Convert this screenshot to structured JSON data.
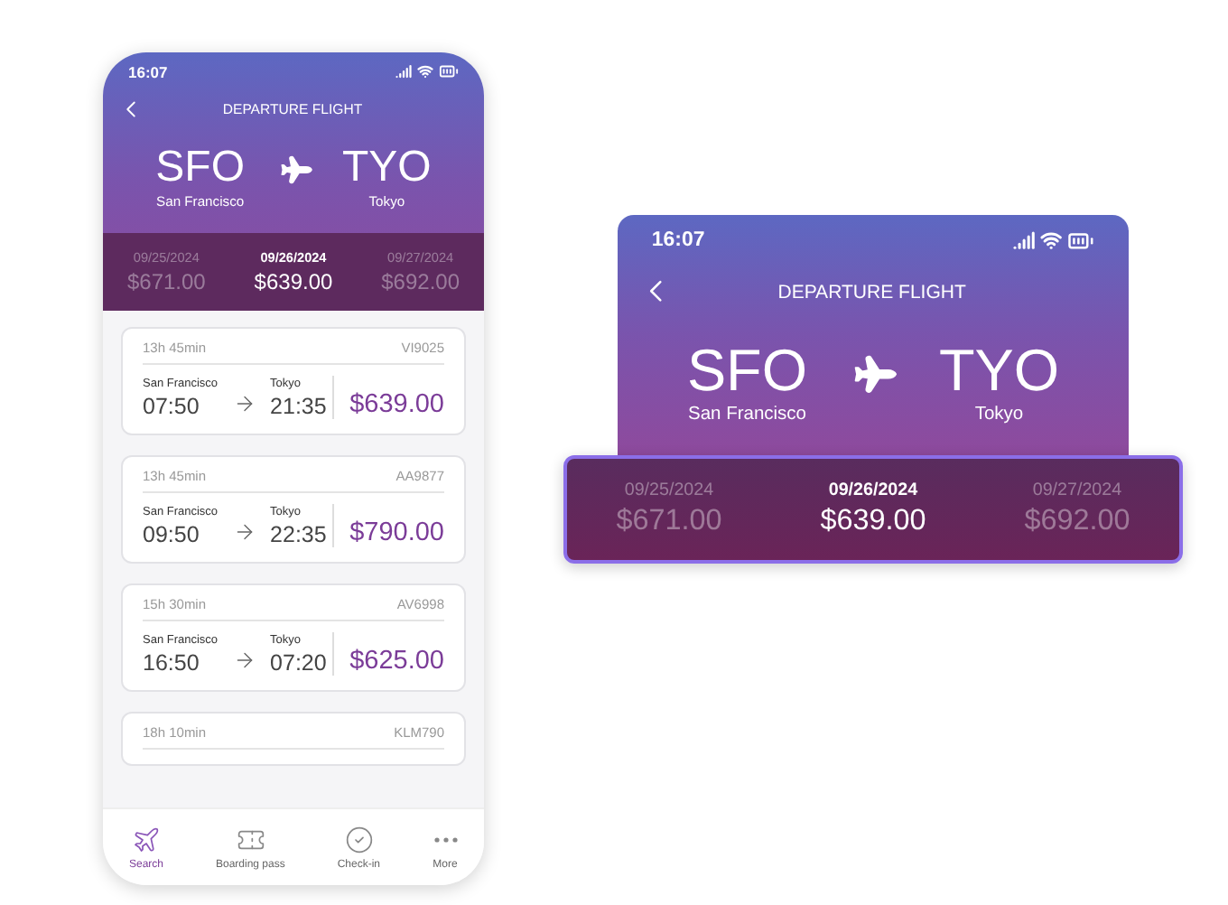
{
  "phone": {
    "status_time": "16:07",
    "title": "DEPARTURE FLIGHT",
    "origin": {
      "code": "SFO",
      "city": "San Francisco"
    },
    "destination": {
      "code": "TYO",
      "city": "Tokyo"
    },
    "dates": [
      {
        "date": "09/25/2024",
        "price": "$671.00",
        "selected": false
      },
      {
        "date": "09/26/2024",
        "price": "$639.00",
        "selected": true
      },
      {
        "date": "09/27/2024",
        "price": "$692.00",
        "selected": false
      }
    ],
    "flights": [
      {
        "duration": "13h 45min",
        "code": "VI9025",
        "from_city": "San Francisco",
        "to_city": "Tokyo",
        "depart": "07:50",
        "arrive": "21:35",
        "price": "$639.00"
      },
      {
        "duration": "13h 45min",
        "code": "AA9877",
        "from_city": "San Francisco",
        "to_city": "Tokyo",
        "depart": "09:50",
        "arrive": "22:35",
        "price": "$790.00"
      },
      {
        "duration": "15h 30min",
        "code": "AV6998",
        "from_city": "San Francisco",
        "to_city": "Tokyo",
        "depart": "16:50",
        "arrive": "07:20",
        "price": "$625.00"
      },
      {
        "duration": "18h 10min",
        "code": "KLM790"
      }
    ],
    "nav": [
      {
        "kind": "plane",
        "label": "Search",
        "selected": true
      },
      {
        "kind": "ticket",
        "label": "Boarding pass",
        "selected": false
      },
      {
        "kind": "check",
        "label": "Check-in",
        "selected": false
      },
      {
        "kind": "more",
        "label": "More",
        "selected": false
      }
    ]
  },
  "preview": {
    "status_time": "16:07",
    "title": "DEPARTURE FLIGHT",
    "origin": {
      "code": "SFO",
      "city": "San Francisco"
    },
    "destination": {
      "code": "TYO",
      "city": "Tokyo"
    },
    "dates": [
      {
        "date": "09/25/2024",
        "price": "$671.00",
        "selected": false
      },
      {
        "date": "09/26/2024",
        "price": "$639.00",
        "selected": true
      },
      {
        "date": "09/27/2024",
        "price": "$692.00",
        "selected": false
      }
    ]
  }
}
